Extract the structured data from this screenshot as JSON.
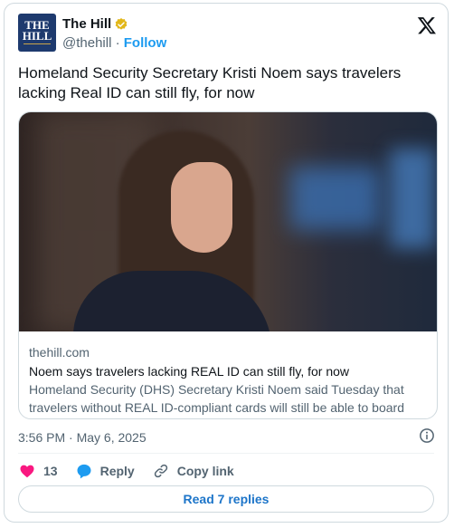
{
  "author": {
    "name": "The Hill",
    "handle": "@thehill",
    "separator": " · ",
    "follow_label": "Follow",
    "avatar_text_line1": "THE",
    "avatar_text_line2": "HILL",
    "verified_icon": "verified-badge-icon",
    "verified_color": "#e2b719"
  },
  "tweet": {
    "text": "Homeland Security Secretary Kristi Noem says travelers lacking Real ID can still fly, for now",
    "timestamp": "3:56 PM · May 6, 2025"
  },
  "link_card": {
    "domain": "thehill.com",
    "title": "Noem says travelers lacking REAL ID can still fly, for now",
    "description": "Homeland Security (DHS) Secretary Kristi Noem said Tuesday that travelers without REAL ID-compliant cards will still be able to board their..."
  },
  "actions": {
    "like_count": "13",
    "reply_label": "Reply",
    "copy_link_label": "Copy link"
  },
  "read_replies_label": "Read 7 replies",
  "colors": {
    "like": "#f91880",
    "reply": "#1d9bf0",
    "accent": "#1d9bf0",
    "text": "#0f1419",
    "muted": "#536471",
    "border": "#cfd9de"
  }
}
